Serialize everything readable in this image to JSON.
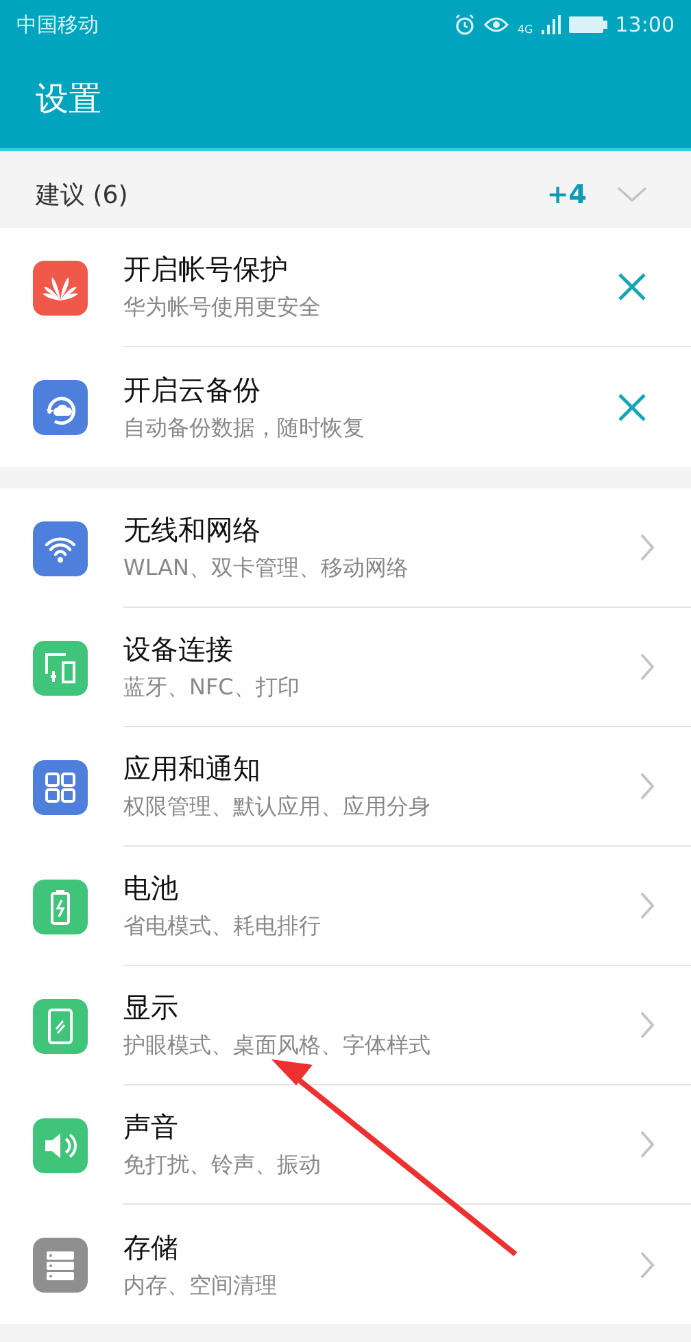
{
  "status_bar": {
    "carrier": "中国移动",
    "network": "4G",
    "time": "13:00"
  },
  "title": "设置",
  "suggestions": {
    "header": "建议 (6)",
    "more": "+4",
    "expanded": false,
    "items": [
      {
        "title": "开启帐号保护",
        "subtitle": "华为帐号使用更安全",
        "color": "#f0584a"
      },
      {
        "title": "开启云备份",
        "subtitle": "自动备份数据，随时恢复",
        "color": "#4f7fdc"
      }
    ]
  },
  "settings": [
    {
      "title": "无线和网络",
      "subtitle": "WLAN、双卡管理、移动网络",
      "color": "#4f7fdc"
    },
    {
      "title": "设备连接",
      "subtitle": "蓝牙、NFC、打印",
      "color": "#3fc47a"
    },
    {
      "title": "应用和通知",
      "subtitle": "权限管理、默认应用、应用分身",
      "color": "#4f7fdc"
    },
    {
      "title": "电池",
      "subtitle": "省电模式、耗电排行",
      "color": "#3fc47a"
    },
    {
      "title": "显示",
      "subtitle": "护眼模式、桌面风格、字体样式",
      "color": "#3fc47a"
    },
    {
      "title": "声音",
      "subtitle": "免打扰、铃声、振动",
      "color": "#3fc47a"
    },
    {
      "title": "存储",
      "subtitle": "内存、空间清理",
      "color": "#8f8f8f"
    }
  ]
}
